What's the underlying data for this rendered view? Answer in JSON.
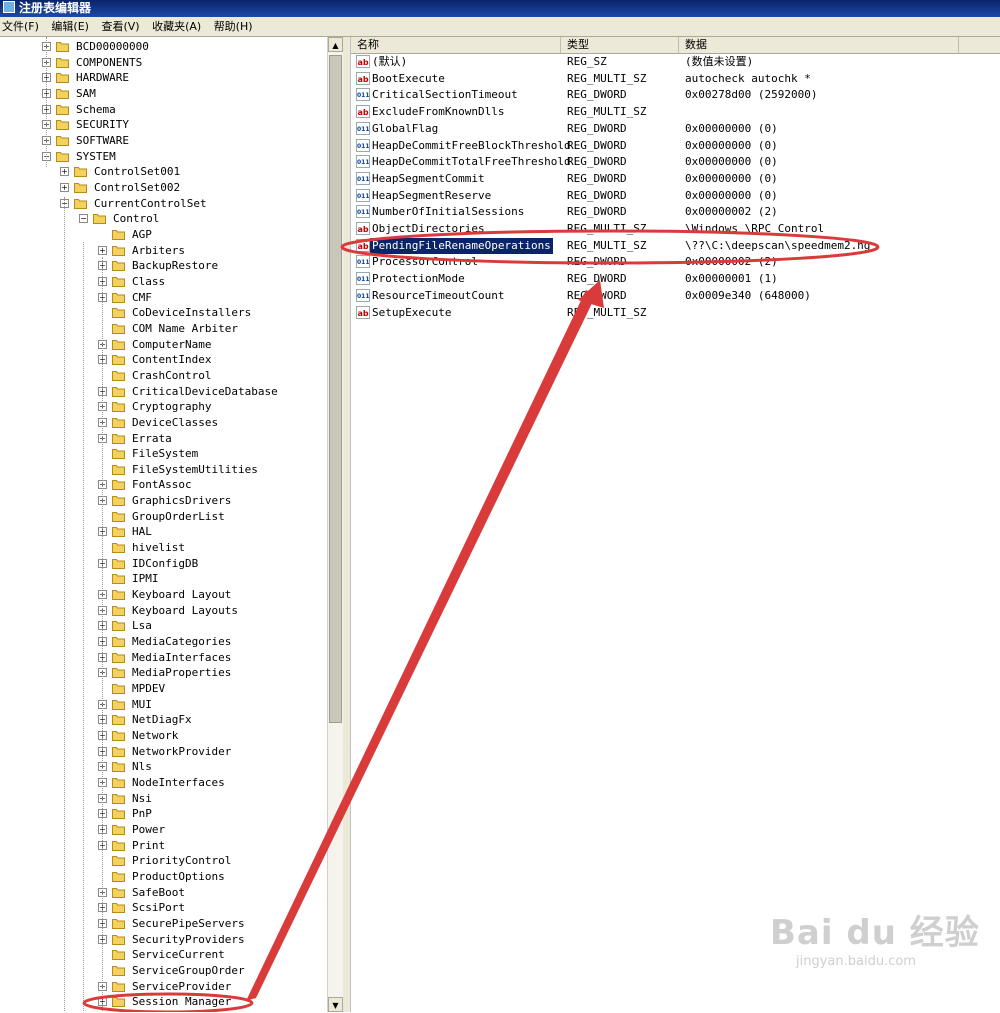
{
  "window": {
    "title": "注册表编辑器"
  },
  "menu": [
    "文件(F)",
    "编辑(E)",
    "查看(V)",
    "收藏夹(A)",
    "帮助(H)"
  ],
  "tree": [
    {
      "label": "BCD00000000",
      "level": 0,
      "exp": "+"
    },
    {
      "label": "COMPONENTS",
      "level": 0,
      "exp": "+"
    },
    {
      "label": "HARDWARE",
      "level": 0,
      "exp": "+"
    },
    {
      "label": "SAM",
      "level": 0,
      "exp": "+"
    },
    {
      "label": "Schema",
      "level": 0,
      "exp": "+"
    },
    {
      "label": "SECURITY",
      "level": 0,
      "exp": "+"
    },
    {
      "label": "SOFTWARE",
      "level": 0,
      "exp": "+"
    },
    {
      "label": "SYSTEM",
      "level": 0,
      "exp": "-"
    },
    {
      "label": "ControlSet001",
      "level": 1,
      "exp": "+"
    },
    {
      "label": "ControlSet002",
      "level": 1,
      "exp": "+"
    },
    {
      "label": "CurrentControlSet",
      "level": 1,
      "exp": "-"
    },
    {
      "label": "Control",
      "level": 2,
      "exp": "-"
    },
    {
      "label": "AGP",
      "level": 3,
      "exp": ""
    },
    {
      "label": "Arbiters",
      "level": 3,
      "exp": "+"
    },
    {
      "label": "BackupRestore",
      "level": 3,
      "exp": "+"
    },
    {
      "label": "Class",
      "level": 3,
      "exp": "+"
    },
    {
      "label": "CMF",
      "level": 3,
      "exp": "+"
    },
    {
      "label": "CoDeviceInstallers",
      "level": 3,
      "exp": ""
    },
    {
      "label": "COM Name Arbiter",
      "level": 3,
      "exp": ""
    },
    {
      "label": "ComputerName",
      "level": 3,
      "exp": "+"
    },
    {
      "label": "ContentIndex",
      "level": 3,
      "exp": "+"
    },
    {
      "label": "CrashControl",
      "level": 3,
      "exp": ""
    },
    {
      "label": "CriticalDeviceDatabase",
      "level": 3,
      "exp": "+"
    },
    {
      "label": "Cryptography",
      "level": 3,
      "exp": "+"
    },
    {
      "label": "DeviceClasses",
      "level": 3,
      "exp": "+"
    },
    {
      "label": "Errata",
      "level": 3,
      "exp": "+"
    },
    {
      "label": "FileSystem",
      "level": 3,
      "exp": ""
    },
    {
      "label": "FileSystemUtilities",
      "level": 3,
      "exp": ""
    },
    {
      "label": "FontAssoc",
      "level": 3,
      "exp": "+"
    },
    {
      "label": "GraphicsDrivers",
      "level": 3,
      "exp": "+"
    },
    {
      "label": "GroupOrderList",
      "level": 3,
      "exp": ""
    },
    {
      "label": "HAL",
      "level": 3,
      "exp": "+"
    },
    {
      "label": "hivelist",
      "level": 3,
      "exp": ""
    },
    {
      "label": "IDConfigDB",
      "level": 3,
      "exp": "+"
    },
    {
      "label": "IPMI",
      "level": 3,
      "exp": ""
    },
    {
      "label": "Keyboard Layout",
      "level": 3,
      "exp": "+"
    },
    {
      "label": "Keyboard Layouts",
      "level": 3,
      "exp": "+"
    },
    {
      "label": "Lsa",
      "level": 3,
      "exp": "+"
    },
    {
      "label": "MediaCategories",
      "level": 3,
      "exp": "+"
    },
    {
      "label": "MediaInterfaces",
      "level": 3,
      "exp": "+"
    },
    {
      "label": "MediaProperties",
      "level": 3,
      "exp": "+"
    },
    {
      "label": "MPDEV",
      "level": 3,
      "exp": ""
    },
    {
      "label": "MUI",
      "level": 3,
      "exp": "+"
    },
    {
      "label": "NetDiagFx",
      "level": 3,
      "exp": "+"
    },
    {
      "label": "Network",
      "level": 3,
      "exp": "+"
    },
    {
      "label": "NetworkProvider",
      "level": 3,
      "exp": "+"
    },
    {
      "label": "Nls",
      "level": 3,
      "exp": "+"
    },
    {
      "label": "NodeInterfaces",
      "level": 3,
      "exp": "+"
    },
    {
      "label": "Nsi",
      "level": 3,
      "exp": "+"
    },
    {
      "label": "PnP",
      "level": 3,
      "exp": "+"
    },
    {
      "label": "Power",
      "level": 3,
      "exp": "+"
    },
    {
      "label": "Print",
      "level": 3,
      "exp": "+"
    },
    {
      "label": "PriorityControl",
      "level": 3,
      "exp": ""
    },
    {
      "label": "ProductOptions",
      "level": 3,
      "exp": ""
    },
    {
      "label": "SafeBoot",
      "level": 3,
      "exp": "+"
    },
    {
      "label": "ScsiPort",
      "level": 3,
      "exp": "+"
    },
    {
      "label": "SecurePipeServers",
      "level": 3,
      "exp": "+"
    },
    {
      "label": "SecurityProviders",
      "level": 3,
      "exp": "+"
    },
    {
      "label": "ServiceCurrent",
      "level": 3,
      "exp": ""
    },
    {
      "label": "ServiceGroupOrder",
      "level": 3,
      "exp": ""
    },
    {
      "label": "ServiceProvider",
      "level": 3,
      "exp": "+"
    },
    {
      "label": "Session Manager",
      "level": 3,
      "exp": "+"
    }
  ],
  "columns": [
    "名称",
    "类型",
    "数据"
  ],
  "values": [
    {
      "name": "(默认)",
      "type": "REG_SZ",
      "data": "(数值未设置)",
      "icon": "ab"
    },
    {
      "name": "BootExecute",
      "type": "REG_MULTI_SZ",
      "data": "autocheck autochk *",
      "icon": "ab"
    },
    {
      "name": "CriticalSectionTimeout",
      "type": "REG_DWORD",
      "data": "0x00278d00 (2592000)",
      "icon": "bin"
    },
    {
      "name": "ExcludeFromKnownDlls",
      "type": "REG_MULTI_SZ",
      "data": "",
      "icon": "ab"
    },
    {
      "name": "GlobalFlag",
      "type": "REG_DWORD",
      "data": "0x00000000 (0)",
      "icon": "bin"
    },
    {
      "name": "HeapDeCommitFreeBlockThreshold",
      "type": "REG_DWORD",
      "data": "0x00000000 (0)",
      "icon": "bin"
    },
    {
      "name": "HeapDeCommitTotalFreeThreshold",
      "type": "REG_DWORD",
      "data": "0x00000000 (0)",
      "icon": "bin"
    },
    {
      "name": "HeapSegmentCommit",
      "type": "REG_DWORD",
      "data": "0x00000000 (0)",
      "icon": "bin"
    },
    {
      "name": "HeapSegmentReserve",
      "type": "REG_DWORD",
      "data": "0x00000000 (0)",
      "icon": "bin"
    },
    {
      "name": "NumberOfInitialSessions",
      "type": "REG_DWORD",
      "data": "0x00000002 (2)",
      "icon": "bin"
    },
    {
      "name": "ObjectDirectories",
      "type": "REG_MULTI_SZ",
      "data": "\\Windows \\RPC Control",
      "icon": "ab"
    },
    {
      "name": "PendingFileRenameOperations",
      "type": "REG_MULTI_SZ",
      "data": "\\??\\C:\\deepscan\\speedmem2.hg",
      "icon": "ab",
      "selected": true
    },
    {
      "name": "ProcessorControl",
      "type": "REG_DWORD",
      "data": "0x00000002 (2)",
      "icon": "bin"
    },
    {
      "name": "ProtectionMode",
      "type": "REG_DWORD",
      "data": "0x00000001 (1)",
      "icon": "bin"
    },
    {
      "name": "ResourceTimeoutCount",
      "type": "REG_DWORD",
      "data": "0x0009e340 (648000)",
      "icon": "bin"
    },
    {
      "name": "SetupExecute",
      "type": "REG_MULTI_SZ",
      "data": "",
      "icon": "ab"
    }
  ],
  "watermark": {
    "brand": "Bai du 经验",
    "url": "jingyan.baidu.com"
  },
  "colors": {
    "annotation": "#d93a3a",
    "selection": "#0a246a",
    "folder": "#f2d15c"
  }
}
